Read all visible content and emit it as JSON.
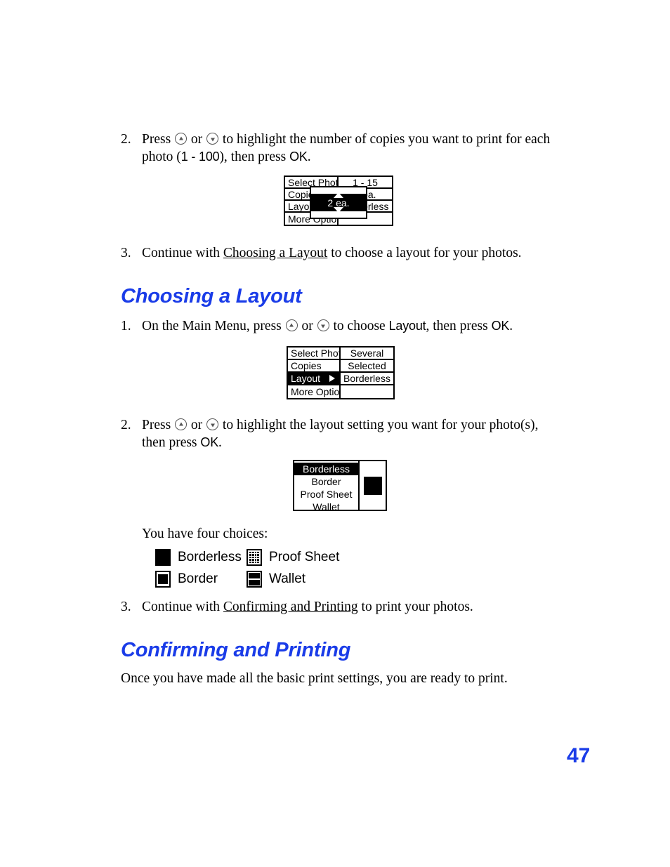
{
  "page": {
    "number": "47",
    "accent_color": "#1a3ce8"
  },
  "steps": {
    "copies_step2": {
      "num": "2.",
      "t1": "Press ",
      "t2": " or ",
      "t3": " to highlight the number of copies you want to print for each photo (",
      "range": "1 - 100",
      "t4": "), then press ",
      "ok": "OK",
      "t5": "."
    },
    "copies_step3": {
      "num": "3.",
      "t1": "Continue with ",
      "xref": "Choosing a Layout",
      "t2": " to choose a layout for your photos."
    },
    "layout_step1": {
      "num": "1.",
      "t1": "On the Main Menu, press ",
      "t2": " or ",
      "t3": " to choose ",
      "term": "Layout",
      "t4": ", then press ",
      "ok": "OK",
      "t5": "."
    },
    "layout_step2": {
      "num": "2.",
      "t1": "Press ",
      "t2": " or ",
      "t3": " to highlight the layout setting you want for your photo(s), then press ",
      "ok": "OK",
      "t4": "."
    },
    "layout_step3": {
      "num": "3.",
      "t1": "Continue with ",
      "xref": "Confirming and Printing",
      "t2": " to print your photos."
    }
  },
  "headings": {
    "choosing_layout": "Choosing a Layout",
    "confirming_printing": "Confirming and Printing"
  },
  "paragraphs": {
    "four_choices": "You have four choices:",
    "confirm_intro": "Once you have made all the basic print settings, you are ready to print."
  },
  "lcd_copies": {
    "rows": [
      {
        "left": "Select Photo",
        "right": "1 - 15",
        "selected": false
      },
      {
        "left": "Copies",
        "right": "2 ea.",
        "selected": false
      },
      {
        "left": "Layout",
        "right": "Borderless",
        "selected": false
      },
      {
        "left": "More Options",
        "right": "",
        "selected": false
      }
    ],
    "popup_value": "2 ea."
  },
  "lcd_menu": {
    "rows": [
      {
        "left": "Select Photo",
        "right": "Several",
        "selected": false
      },
      {
        "left": "Copies",
        "right": "Selected",
        "selected": false
      },
      {
        "left": "Layout",
        "right": "Borderless",
        "selected": true
      },
      {
        "left": "More Options",
        "right": "",
        "selected": false
      }
    ]
  },
  "lcd_layout_list": {
    "items": [
      {
        "label": "Borderless",
        "selected": true
      },
      {
        "label": "Border",
        "selected": false
      },
      {
        "label": "Proof Sheet",
        "selected": false
      },
      {
        "label": "Wallet",
        "selected": false
      }
    ]
  },
  "choices": [
    {
      "icon": "borderless-icon",
      "label": "Borderless"
    },
    {
      "icon": "proof-sheet-icon",
      "label": "Proof Sheet"
    },
    {
      "icon": "border-icon",
      "label": "Border"
    },
    {
      "icon": "wallet-icon",
      "label": "Wallet"
    }
  ]
}
